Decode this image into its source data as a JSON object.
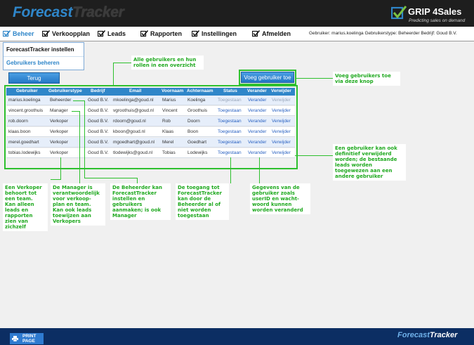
{
  "header": {
    "logo_part1": "Forecast",
    "logo_part2": "Tracker",
    "brand_name": "GRIP 4Sales",
    "brand_tagline": "Predicting sales on demand"
  },
  "nav": {
    "items": [
      {
        "label": "Beheer",
        "icon": "checkbox-icon",
        "active": true
      },
      {
        "label": "Verkoopplan",
        "icon": "checkbox-icon"
      },
      {
        "label": "Leads",
        "icon": "checkbox-icon"
      },
      {
        "label": "Rapporten",
        "icon": "checkbox-icon"
      },
      {
        "label": "Instellingen",
        "icon": "checkbox-icon"
      },
      {
        "label": "Afmelden",
        "icon": "checkbox-icon"
      }
    ],
    "userinfo": "Gebruiker: marius.koelinga Gebruikerstype: Beheerder Bedrijf: Goud B.V."
  },
  "dropdown": {
    "items": [
      "ForecastTracker instellen",
      "Gebruikers beheren"
    ]
  },
  "buttons": {
    "back": "Terug",
    "add_user": "Voeg gebruiker toe"
  },
  "table": {
    "headers": [
      "Gebruiker",
      "Gebruikerstype",
      "Bedrijf",
      "Email",
      "Voornaam",
      "Achternaam",
      "Status",
      "Verander",
      "Verwijder"
    ],
    "rows": [
      {
        "user": "marius.koelinga",
        "type": "Beheerder",
        "company": "Goud B.V.",
        "email": "mkoelinga@goud.nl",
        "first": "Marius",
        "last": "Koelinga",
        "status": "Toegestaan",
        "edit": "Verander",
        "delete": "Verwijder"
      },
      {
        "user": "vincent.groothuis",
        "type": "Manager",
        "company": "Goud B.V.",
        "email": "vgroothuis@goud.nl",
        "first": "Vincent",
        "last": "Groothuis",
        "status": "Toegestaan",
        "edit": "Verander",
        "delete": "Verwijder"
      },
      {
        "user": "rob.doorn",
        "type": "Verkoper",
        "company": "Goud B.V.",
        "email": "rdoorn@goud.nl",
        "first": "Rob",
        "last": "Doorn",
        "status": "Toegestaan",
        "edit": "Verander",
        "delete": "Verwijder"
      },
      {
        "user": "klaas.boon",
        "type": "Verkoper",
        "company": "Goud B.V.",
        "email": "kboon@goud.nl",
        "first": "Klaas",
        "last": "Boon",
        "status": "Toegestaan",
        "edit": "Verander",
        "delete": "Verwijder"
      },
      {
        "user": "merel.goedhart",
        "type": "Verkoper",
        "company": "Goud B.V.",
        "email": "mgoedhart@goud.nl",
        "first": "Merel",
        "last": "Goedhart",
        "status": "Toegestaan",
        "edit": "Verander",
        "delete": "Verwijder"
      },
      {
        "user": "tobias.lodewijks",
        "type": "Verkoper",
        "company": "Goud B.V.",
        "email": "tlodewijks@goud.nl",
        "first": "Tobias",
        "last": "Lodewijks",
        "status": "Toegestaan",
        "edit": "Verander",
        "delete": "Verwijder"
      }
    ]
  },
  "callouts": {
    "overview": [
      "Alle gebruikers en hun",
      "rollen in een overzicht"
    ],
    "add": [
      "Voeg gebruikers toe",
      "via deze knop"
    ],
    "delete": [
      "Een gebruiker kan ook",
      "definitief verwijderd",
      "worden; de bestaande",
      "leads worden",
      "toegewezen aan een",
      "andere gebruiker"
    ],
    "verkoper": [
      "Een Verkoper",
      "behoort tot",
      "een team.",
      "Kan alleen",
      "leads en",
      "rapporten",
      "zien van",
      "zichzelf"
    ],
    "manager": [
      "De Manager is",
      "verantwoordelijk",
      "voor verkoop-",
      "plan en team.",
      "Kan ook leads",
      "toewijzen aan",
      "Verkopers"
    ],
    "beheerder": [
      "De Beheerder kan",
      "ForecastTracker",
      "instellen en",
      "gebruikers",
      "aanmaken; is ook",
      "Manager"
    ],
    "status": [
      "De toegang tot",
      "ForecastTracker",
      "kan door de",
      "Beheerder al of",
      "niet worden",
      "toegestaan"
    ],
    "edit": [
      "Gegevens van de",
      "gebruiker zoals",
      "userID en wacht-",
      "woord kunnen",
      "worden veranderd"
    ]
  },
  "footer": {
    "logo_part1": "Forecast",
    "logo_part2": "Tracker",
    "print_line1": "PRINT",
    "print_line2": "PAGE"
  },
  "colors": {
    "accent_blue": "#2f86c9",
    "callout_green": "#1fa91f",
    "header_dark": "#1e1e1e",
    "footer_navy": "#0c2e63"
  }
}
